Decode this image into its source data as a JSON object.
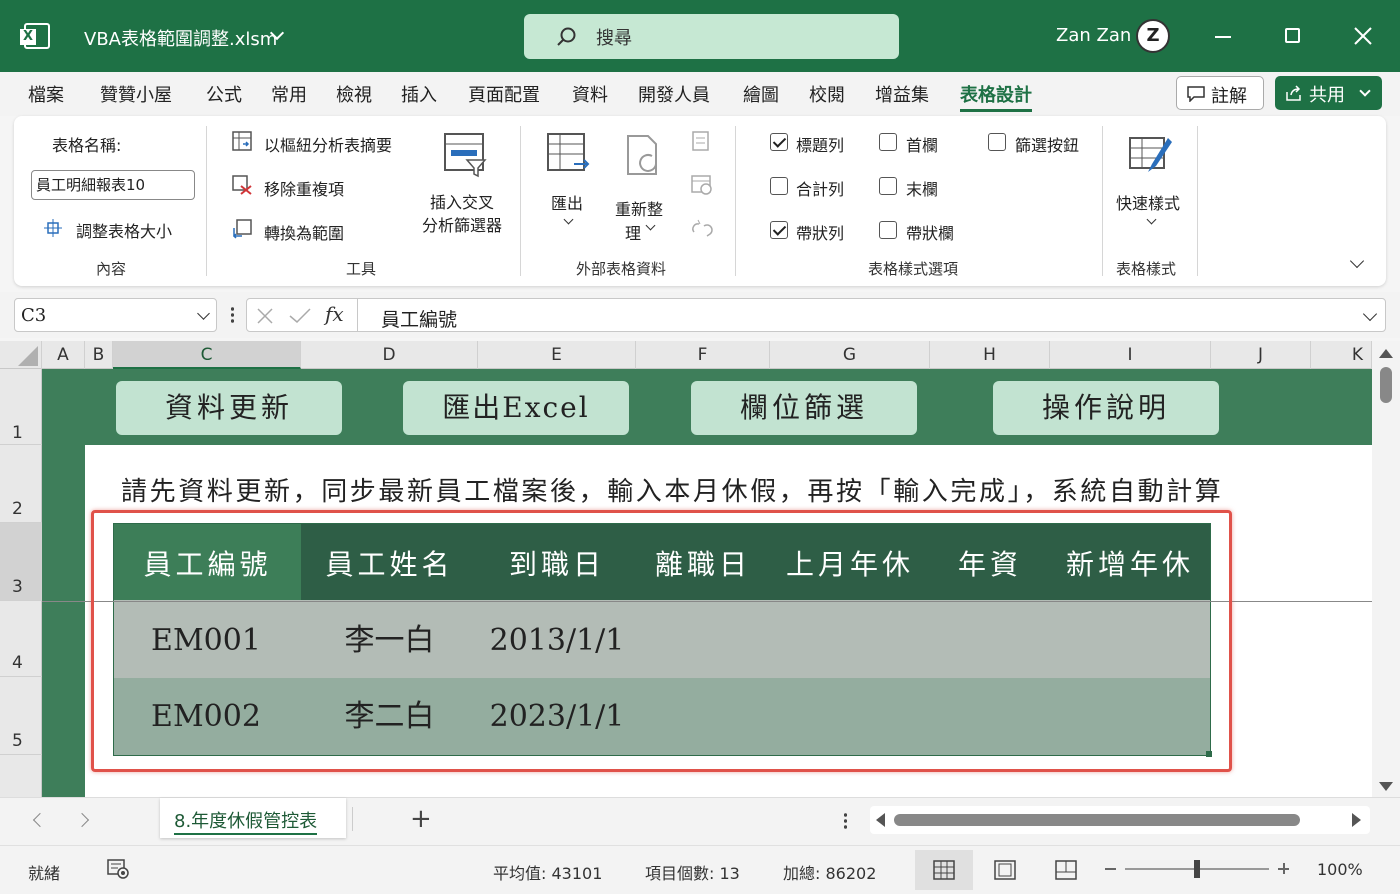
{
  "titlebar": {
    "file_name": "VBA表格範圍調整.xlsm",
    "search_placeholder": "搜尋",
    "user_name": "Zan Zan",
    "avatar_text": "Z"
  },
  "menu": {
    "items": [
      "檔案",
      "贊贊小屋",
      "公式",
      "常用",
      "檢視",
      "插入",
      "頁面配置",
      "資料",
      "開發人員",
      "繪圖",
      "校閱",
      "增益集",
      "表格設計"
    ],
    "comment_label": "註解",
    "share_label": "共用"
  },
  "ribbon": {
    "table_name_label": "表格名稱:",
    "table_name_value": "員工明細報表10",
    "resize_label": "調整表格大小",
    "group_properties": "內容",
    "pivot_summary": "以樞紐分析表摘要",
    "remove_dup": "移除重複項",
    "convert_range": "轉換為範圍",
    "slicer_line1": "插入交叉",
    "slicer_line2": "分析篩選器",
    "group_tools": "工具",
    "export_label": "匯出",
    "refresh_line1": "重新整",
    "refresh_line2": "理",
    "group_external": "外部表格資料",
    "header_row": "標題列",
    "total_row": "合計列",
    "banded_rows": "帶狀列",
    "first_col": "首欄",
    "last_col": "末欄",
    "banded_cols": "帶狀欄",
    "filter_btn": "篩選按鈕",
    "group_style_options": "表格樣式選項",
    "quick_styles": "快速樣式",
    "group_styles": "表格樣式"
  },
  "formula": {
    "name_box": "C3",
    "fx": "fx",
    "value": "員工編號"
  },
  "columns": [
    "A",
    "B",
    "C",
    "D",
    "E",
    "F",
    "G",
    "H",
    "I",
    "J",
    "K"
  ],
  "rows": [
    "1",
    "2",
    "3",
    "4",
    "5"
  ],
  "sheet": {
    "buttons": [
      "資料更新",
      "匯出Excel",
      "欄位篩選",
      "操作說明"
    ],
    "note": "請先資料更新，同步最新員工檔案後，輸入本月休假，再按「輸入完成」，系統自動計算",
    "table_headers": [
      "員工編號",
      "員工姓名",
      "到職日",
      "離職日",
      "上月年休",
      "年資",
      "新增年休"
    ],
    "table_rows": [
      [
        "EM001",
        "李一白",
        "2013/1/1"
      ],
      [
        "EM002",
        "李二白",
        "2023/1/1"
      ]
    ]
  },
  "tabs": {
    "active": "8.年度休假管控表",
    "add": "+"
  },
  "status": {
    "ready": "就緒",
    "average": "平均值: 43101",
    "count": "項目個數: 13",
    "sum": "加總: 86202",
    "zoom": "100%"
  },
  "colors": {
    "excel_green": "#1e7145",
    "sheet_green": "#3e7e5a",
    "header_dark": "#2e5e46",
    "selection_red": "#e0524a"
  }
}
